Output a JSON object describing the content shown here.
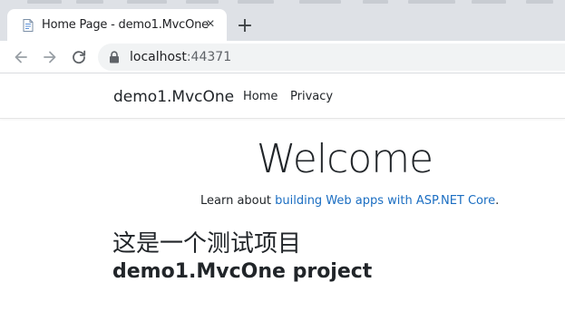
{
  "browser": {
    "tab": {
      "title": "Home Page - demo1.MvcOne",
      "close_glyph": "×"
    },
    "new_tab_glyph": "+",
    "address": {
      "host": "localhost",
      "port": ":44371"
    }
  },
  "site": {
    "brand": "demo1.MvcOne",
    "nav": [
      {
        "label": "Home"
      },
      {
        "label": "Privacy"
      }
    ],
    "heading": "Welcome",
    "learn": {
      "prefix": "Learn about ",
      "link": "building Web apps with ASP.NET Core",
      "suffix": "."
    },
    "cn_heading": "这是一个测试项目",
    "en_heading": "demo1.MvcOne project"
  },
  "colors": {
    "link": "#1b6ec2",
    "chrome": "#dee1e6",
    "text": "#212529"
  },
  "icons": [
    "document-icon",
    "close-icon",
    "back-arrow-icon",
    "forward-arrow-icon",
    "reload-icon",
    "lock-icon"
  ]
}
